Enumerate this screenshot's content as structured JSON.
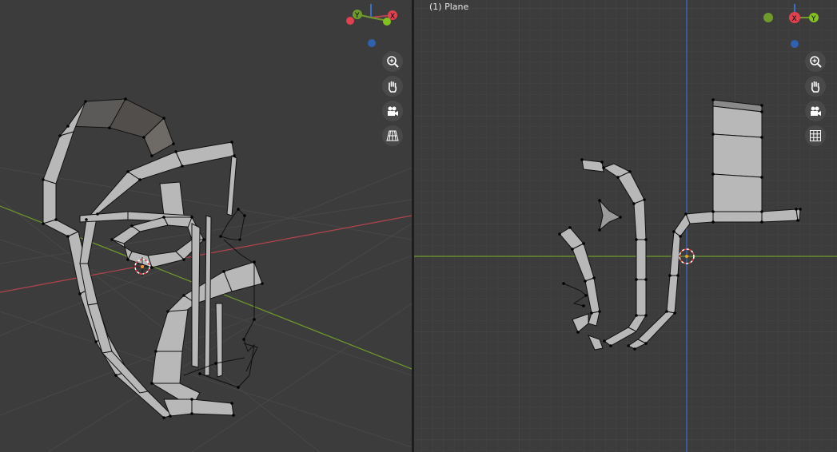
{
  "left_viewport": {
    "type": "perspective",
    "gizmo": {
      "axes": [
        "X",
        "Y",
        "Z"
      ],
      "labels": {
        "x": "X",
        "y": "Y"
      }
    },
    "nav_buttons": [
      "zoom-icon",
      "hand-pan-icon",
      "camera-icon",
      "perspective-grid-icon"
    ]
  },
  "right_viewport": {
    "label": "(1) Plane",
    "type": "orthographic",
    "gizmo": {
      "axes": [
        "X",
        "Y",
        "Z"
      ],
      "labels": {
        "x": "X",
        "y": "Y"
      }
    },
    "nav_buttons": [
      "zoom-icon",
      "hand-pan-icon",
      "camera-icon",
      "ortho-grid-icon"
    ]
  },
  "colors": {
    "background": "#3c3c3c",
    "grid": "#454545",
    "x_axis": "#b3444d",
    "y_axis": "#6f9b2c",
    "z_axis": "#3d6fc4",
    "mesh_face": "#b8b8b8",
    "mesh_selected": "#5a5a5a",
    "edge": "#000000"
  }
}
